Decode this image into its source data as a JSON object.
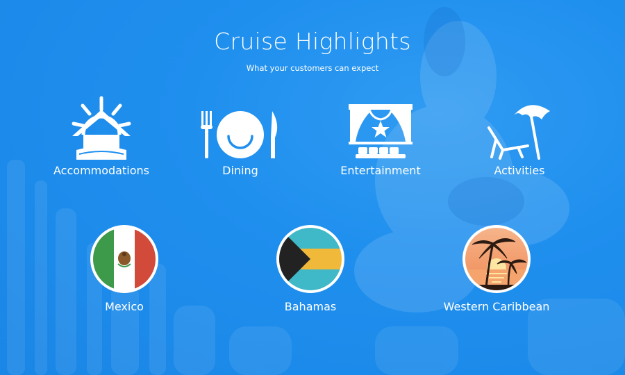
{
  "header": {
    "title": "Cruise Highlights",
    "subtitle": "What your customers can expect"
  },
  "highlights": [
    {
      "label": "Accommodations",
      "icon": "house-helm-icon"
    },
    {
      "label": "Dining",
      "icon": "plate-cutlery-icon"
    },
    {
      "label": "Entertainment",
      "icon": "theater-stage-icon"
    },
    {
      "label": "Activities",
      "icon": "beach-umbrella-chair-icon"
    }
  ],
  "destinations": [
    {
      "label": "Mexico",
      "icon": "mexico-flag-icon"
    },
    {
      "label": "Bahamas",
      "icon": "bahamas-flag-icon"
    },
    {
      "label": "Western Caribbean",
      "icon": "palm-sunset-icon"
    }
  ],
  "colors": {
    "background": "#1f8fee",
    "text": "#ffffff",
    "mexico_green": "#3d9a4a",
    "mexico_red": "#d14a3a",
    "bahamas_aqua": "#3fb8c8",
    "bahamas_gold": "#f1b93a",
    "sunset_orange": "#f39a5c"
  }
}
